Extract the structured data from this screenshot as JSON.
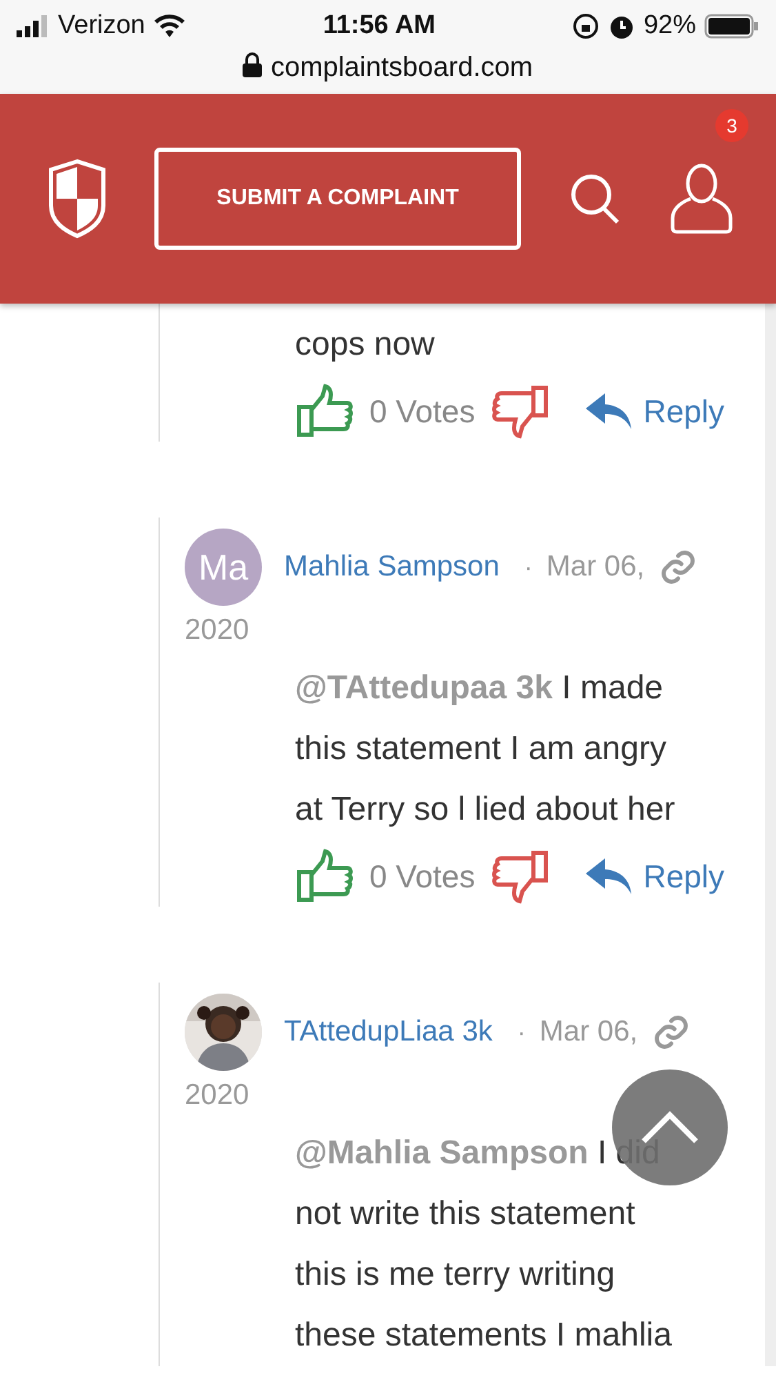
{
  "status_bar": {
    "carrier": "Verizon",
    "time": "11:56 AM",
    "battery": "92%"
  },
  "address_bar": {
    "url": "complaintsboard.com"
  },
  "header": {
    "submit_label": "SUBMIT A COMPLAINT",
    "notification_count": "3"
  },
  "comments": [
    {
      "kind": "fragment",
      "body": "cops now",
      "votes": "0 Votes",
      "reply": "Reply"
    },
    {
      "kind": "full",
      "avatar": {
        "kind": "initials",
        "text": "Ma"
      },
      "author": "Mahlia Sampson",
      "separator": "·",
      "date": "Mar 06,",
      "year": "2020",
      "body": "**@TAttedupaa 3k** I made this statement I am angry at Terry so l lied about her",
      "votes": "0 Votes",
      "reply": "Reply"
    },
    {
      "kind": "full",
      "author": "TAttedupLiaa 3k",
      "separator": "·",
      "date": "Mar 06,",
      "year": "2020",
      "body": "**@Mahlia Sampson** I did not write this statement this is me terry writing these statements I mahlia"
    }
  ]
}
